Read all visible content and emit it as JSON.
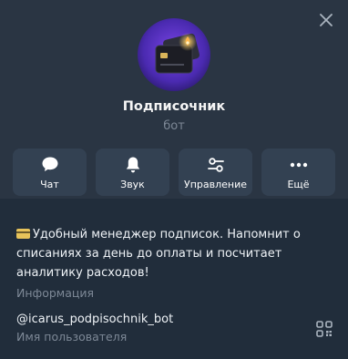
{
  "profile": {
    "name": "Подписочник",
    "type": "бот"
  },
  "actions": [
    {
      "label": "Чат",
      "icon": "chat-bubble-icon"
    },
    {
      "label": "Звук",
      "icon": "bell-icon"
    },
    {
      "label": "Управление",
      "icon": "sliders-icon"
    },
    {
      "label": "Ещё",
      "icon": "more-dots-icon"
    }
  ],
  "info": {
    "description": "Удобный менеджер подписок. Напомнит о списаниях за день до оплаты и посчитает аналитику расходов!",
    "description_label": "Информация",
    "username": "@icarus_podpisochnik_bot",
    "username_label": "Имя пользователя"
  },
  "colors": {
    "header_bg": "#2a3543",
    "body_bg": "#212d3b",
    "button_bg": "#334152",
    "avatar_accent": "#5b36c9"
  }
}
